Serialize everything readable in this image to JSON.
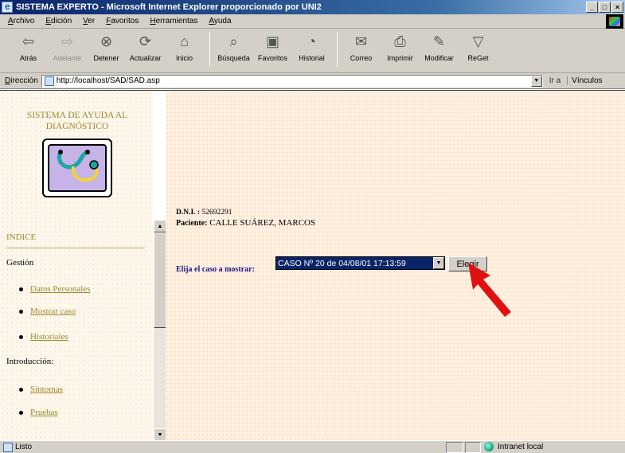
{
  "window": {
    "title": "SISTEMA EXPERTO - Microsoft Internet Explorer proporcionado por UNI2",
    "controls": [
      "_",
      "□",
      "×"
    ]
  },
  "menubar": [
    "Archivo",
    "Edición",
    "Ver",
    "Favoritos",
    "Herramientas",
    "Ayuda"
  ],
  "toolbar": {
    "buttons": [
      {
        "label": "Atrás",
        "icon": "back-arrow-icon"
      },
      {
        "label": "Adelante",
        "icon": "forward-arrow-icon",
        "disabled": true
      },
      {
        "label": "Detener",
        "icon": "stop-icon"
      },
      {
        "label": "Actualizar",
        "icon": "refresh-icon"
      },
      {
        "label": "Inicio",
        "icon": "home-icon"
      },
      {
        "label": "Búsqueda",
        "icon": "search-icon"
      },
      {
        "label": "Favoritos",
        "icon": "favorites-icon"
      },
      {
        "label": "Historial",
        "icon": "history-icon"
      },
      {
        "label": "Correo",
        "icon": "mail-icon"
      },
      {
        "label": "Imprimir",
        "icon": "print-icon"
      },
      {
        "label": "Modificar",
        "icon": "edit-icon"
      },
      {
        "label": "ReGet",
        "icon": "reget-icon"
      }
    ]
  },
  "address": {
    "label": "Dirección",
    "url": "http://localhost/SAD/SAD.asp",
    "go_label": "Ir a",
    "links_label": "Vínculos"
  },
  "sidebar": {
    "title_line1": "SISTEMA DE AYUDA AL",
    "title_line2": "DIAGNÓSTICO",
    "index_label": "INDICE",
    "sections": [
      {
        "label": "Gestión",
        "items": [
          "Datos Personales",
          "Mostrar caso",
          "Historiales"
        ]
      },
      {
        "label": "Introducción:",
        "items": [
          "Síntomas",
          "Pruebas"
        ]
      }
    ]
  },
  "main": {
    "dni_label": "D.N.I. :",
    "dni_value": "52692291",
    "patient_label": "Paciente:",
    "patient_value": "CALLE SUÁREZ, MARCOS",
    "choose_label": "Elija el caso a mostrar:",
    "case_selected": "CASO Nº 20 de 04/08/01 17:13:59",
    "choose_button": "Elegir"
  },
  "statusbar": {
    "status": "Listo",
    "zone": "Intranet local"
  },
  "colors": {
    "title_gradient_start": "#0a246a",
    "sidebar_text": "#9a8a2e",
    "choose_label": "#1a1a8c",
    "pointer_arrow": "#e01010"
  }
}
